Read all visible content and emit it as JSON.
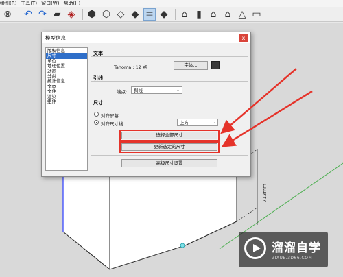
{
  "menubar": {
    "items": [
      "绘图(R)",
      "工具(T)",
      "窗口(W)",
      "帮助(H)"
    ]
  },
  "toolbar": {
    "icons": [
      "circle-x-icon",
      "undo-icon",
      "redo-icon",
      "print-icon",
      "model-info-icon",
      "iso-view-icon",
      "top-view-icon",
      "front-view-icon",
      "right-view-icon",
      "back-view-icon",
      "left-view-icon",
      "xray-icon",
      "wireframe-icon",
      "hidden-line-icon",
      "shaded-icon",
      "textured-icon",
      "monochrome-icon",
      "house-icon",
      "warehouse-icon",
      "home-icon"
    ]
  },
  "dialog": {
    "title": "模型信息",
    "close_label": "x",
    "categories": [
      "版权信息",
      "尺寸",
      "单位",
      "地理位置",
      "动画",
      "分类",
      "统计信息",
      "文本",
      "文件",
      "渲染",
      "组件"
    ],
    "active_category": "尺寸",
    "text_section": {
      "title": "文本",
      "font_value": "Tahoma : 12 点",
      "font_button": "字体...",
      "swatch_color": "#3a3a3a"
    },
    "leader_section": {
      "title": "引线",
      "endpoint_label": "端点:",
      "endpoint_value": "斜线"
    },
    "dimension_section": {
      "title": "尺寸",
      "align_screen_label": "对齐屏幕",
      "align_dim_line_label": "对齐尺寸线",
      "position_value": "上方",
      "selected_option": "对齐尺寸线",
      "select_all_button": "选择全部尺寸",
      "update_selected_button": "更新选定的尺寸",
      "advanced_button": "高级尺寸设置"
    }
  },
  "canvas": {
    "dimension_label": "713mm"
  },
  "watermark": {
    "name": "溜溜自学",
    "url": "ZIXUE.3D66.COM"
  },
  "colors": {
    "highlight": "#e5332a",
    "accent": "#2f6fc9"
  }
}
